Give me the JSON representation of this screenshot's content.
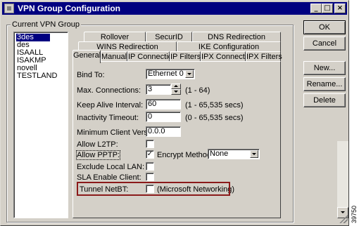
{
  "window": {
    "title": "VPN Group Configuration"
  },
  "titlebar_buttons": {
    "minimize": "_",
    "maximize": "□",
    "close": "×"
  },
  "group_label": "Current VPN Group",
  "vpn_groups": [
    "3des",
    "des",
    "ISAALL",
    "ISAKMP",
    "novell",
    "TESTLAND"
  ],
  "selected_group": "3des",
  "tabs_row1": [
    "Rollover",
    "SecurID",
    "DNS Redirection"
  ],
  "tabs_row2": [
    "WINS Redirection",
    "IKE Configuration"
  ],
  "tabs_row3": [
    "General",
    "Manual",
    "IP Connection",
    "IP Filters",
    "IPX Connection",
    "IPX Filters"
  ],
  "active_tab": "General",
  "form": {
    "bind_to": {
      "label": "Bind To:",
      "value": "Ethernet 0"
    },
    "max_connections": {
      "label": "Max. Connections:",
      "value": "3",
      "range": "(1 - 64)"
    },
    "keep_alive": {
      "label": "Keep Alive Interval:",
      "value": "60",
      "range": "(1 - 65,535 secs)"
    },
    "inactivity": {
      "label": "Inactivity Timeout:",
      "value": "0",
      "range": "(0 - 65,535 secs)"
    },
    "min_client_version": {
      "label": "Minimum Client Version:",
      "value": "0.0.0"
    },
    "allow_l2tp": {
      "label": "Allow L2TP:",
      "checked": false
    },
    "allow_pptp": {
      "label": "Allow PPTP:",
      "checked": true,
      "check_mark": "✓"
    },
    "encrypt_method": {
      "label": "Encrypt Method:",
      "value": "None"
    },
    "exclude_local_lan": {
      "label": "Exclude Local LAN:",
      "checked": false
    },
    "sla_enable_client": {
      "label": "SLA Enable Client:",
      "checked": false
    },
    "tunnel_netbt": {
      "label": "Tunnel NetBT:",
      "checked": false,
      "note": "(Microsoft Networking)"
    }
  },
  "buttons": {
    "ok": "OK",
    "cancel": "Cancel",
    "new": "New...",
    "rename": "Rename...",
    "delete": "Delete"
  },
  "side_number": "39750",
  "colors": {
    "titlebar": "#000080",
    "face": "#d4d0c8",
    "highlight_box": "#8b1a1a"
  }
}
